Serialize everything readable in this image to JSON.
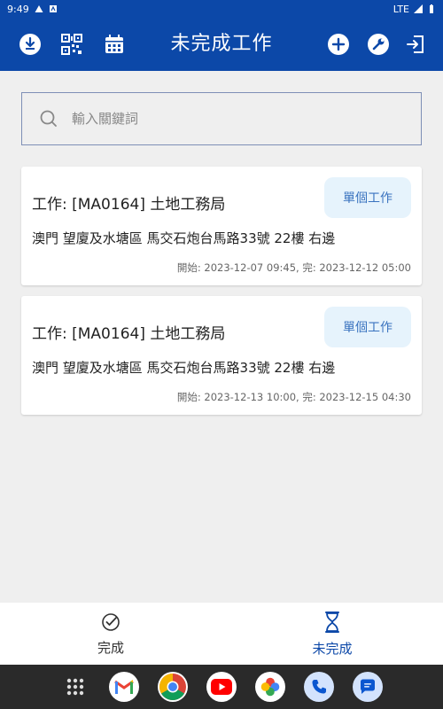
{
  "status_bar": {
    "time": "9:49",
    "network": "LTE"
  },
  "app_bar": {
    "title": "未完成工作",
    "left_icons": [
      "download-icon",
      "qr-code-icon",
      "calendar-icon"
    ],
    "right_icons": [
      "add-circle-icon",
      "wrench-icon",
      "logout-icon"
    ]
  },
  "search": {
    "placeholder": "輸入關鍵詞",
    "value": ""
  },
  "tasks": [
    {
      "title": "工作: [MA0164] 土地工務局",
      "badge": "單個工作",
      "address": "澳門 望廈及水塘區 馬交石炮台馬路33號  22樓 右邊",
      "time": "開始: 2023-12-07 09:45, 完: 2023-12-12 05:00"
    },
    {
      "title": "工作: [MA0164] 土地工務局",
      "badge": "單個工作",
      "address": "澳門 望廈及水塘區 馬交石炮台馬路33號  22樓 右邊",
      "time": "開始: 2023-12-13 10:00, 完: 2023-12-15 04:30"
    }
  ],
  "bottom_nav": {
    "done": {
      "label": "完成",
      "icon": "check-circle-icon"
    },
    "pending": {
      "label": "未完成",
      "icon": "hourglass-icon",
      "active": true
    }
  },
  "dock": [
    "apps-grid-icon",
    "gmail-icon",
    "chrome-icon",
    "youtube-icon",
    "photos-icon",
    "phone-icon",
    "messages-icon"
  ],
  "colors": {
    "primary": "#0c48a8",
    "badge_bg": "#e6f3fc",
    "badge_text": "#3a73bf",
    "background": "#efefef"
  }
}
